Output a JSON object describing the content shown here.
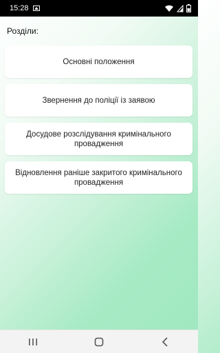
{
  "status": {
    "time": "15:28",
    "battery_percent": "",
    "icons": [
      "gallery-icon",
      "wifi-icon",
      "signal-icon",
      "battery-icon"
    ]
  },
  "header": {
    "label": "Розділи:"
  },
  "menu": {
    "items": [
      {
        "label": "Основні положення"
      },
      {
        "label": "Звернення до поліції із заявою"
      },
      {
        "label": "Досудове розслідування кримінального провадження"
      },
      {
        "label": "Відновлення раніше закритого кримінального провадження"
      }
    ]
  },
  "nav": {
    "icons": [
      "recent-apps-icon",
      "home-icon",
      "back-icon"
    ]
  },
  "colors": {
    "gradient_end": "#9fe8c0",
    "card_bg": "#ffffff",
    "text": "#222222"
  }
}
